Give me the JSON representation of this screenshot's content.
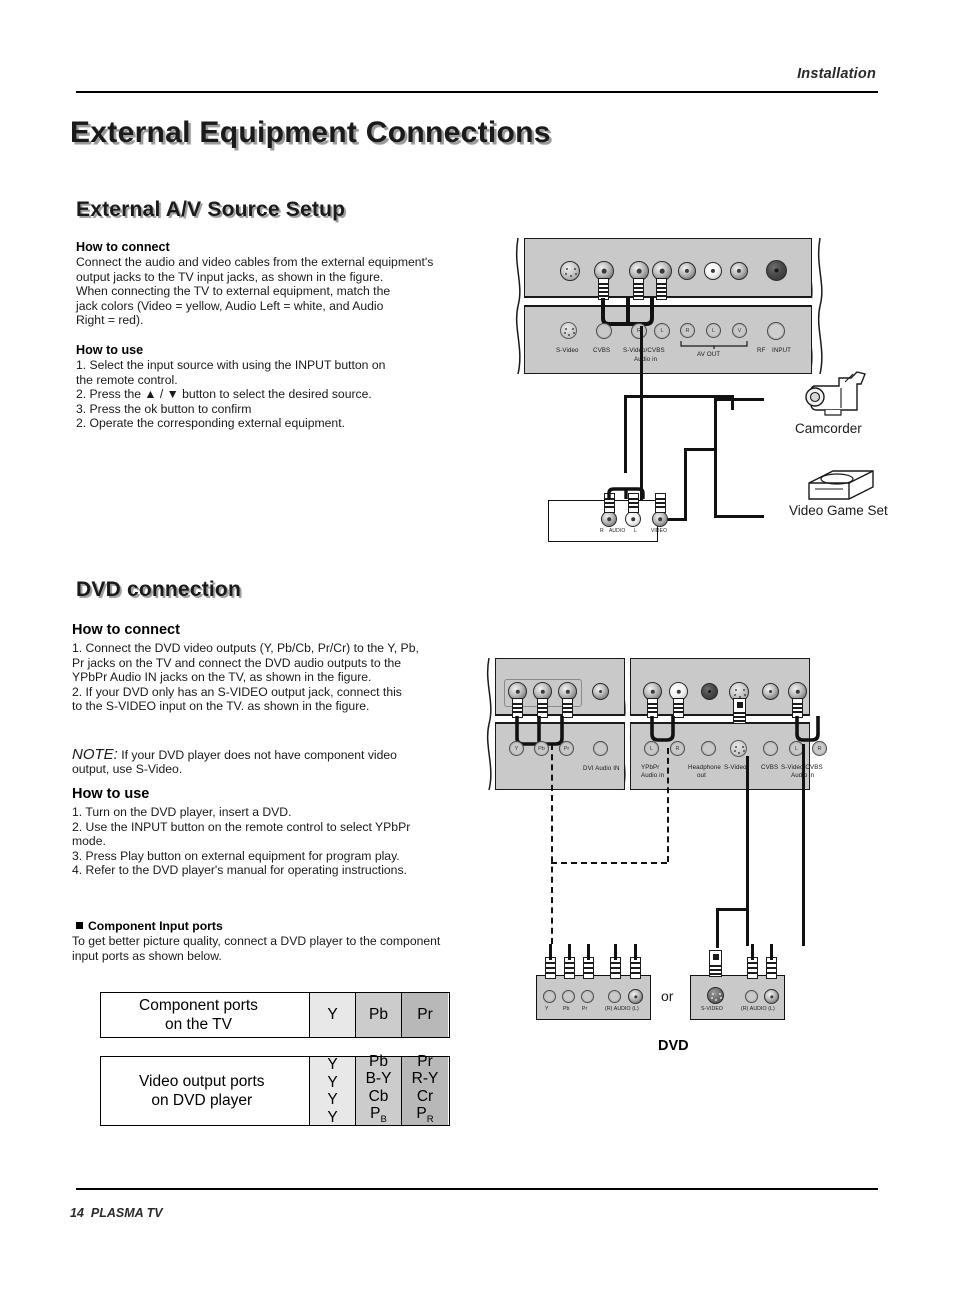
{
  "header": {
    "section": "Installation"
  },
  "titles": {
    "h1": "External Equipment Connections",
    "av_setup": "External A/V Source Setup",
    "dvd_connection": "DVD connection"
  },
  "av_section": {
    "how_to_connect_heading": "How to connect",
    "how_to_connect_body": "Connect the audio and video cables from the external equipment's\noutput jacks to the TV input jacks, as shown in the figure.\nWhen connecting the TV to external equipment, match the\njack colors (Video = yellow, Audio Left = white, and Audio\nRight = red).",
    "how_to_use_heading": "How to use",
    "how_to_use_body": "1. Select the input source with using the INPUT button on\nthe remote control.\n2. Press the ▲ / ▼ button to select the desired source.\n3. Press the ok  button to confirm\n2. Operate the corresponding external equipment."
  },
  "dvd_section": {
    "how_to_connect_heading": "How to connect",
    "how_to_connect_body": "1. Connect the DVD video outputs (Y, Pb/Cb, Pr/Cr) to the Y, Pb,\nPr jacks on the TV and connect the DVD audio outputs to the\nYPbPr Audio IN  jacks on the TV, as shown in the figure.\n2. If your DVD only has an S-VIDEO output jack, connect  this\nto  the S-VIDEO input on the TV. as shown in the figure.",
    "note_label": "NOTE:",
    "note_body": " If your DVD player does not have component video\noutput, use S-Video.",
    "how_to_use_heading": "How to use",
    "how_to_use_body": "1. Turn on the DVD player, insert a DVD.\n2. Use the INPUT button on the remote control to select YPbPr\nmode.\n3. Press Play button on external equipment for program play.\n4. Refer to the DVD player's manual for operating instructions."
  },
  "component_ports": {
    "heading": "Component Input ports",
    "body": "To get better picture quality, connect a DVD player to the component\ninput ports as shown below."
  },
  "tables": {
    "tv_row": {
      "label": "Component ports\non the TV",
      "cols": [
        "Y",
        "Pb",
        "Pr"
      ]
    },
    "dvd_row": {
      "label": "Video output ports\non DVD player",
      "col_y": [
        "Y",
        "Y",
        "Y",
        "Y"
      ],
      "col_pb": [
        "Pb",
        "B-Y",
        "Cb",
        "P"
      ],
      "col_pb_sub": "B",
      "col_pr": [
        "Pr",
        "R-Y",
        "Cr",
        "P"
      ],
      "col_pr_sub": "R"
    },
    "shades": {
      "y": "#e8e8e8",
      "pb": "#cccccc",
      "pr": "#b8b8b8"
    }
  },
  "diagram_av": {
    "jack_labels": [
      "S-Video",
      "CVBS",
      "S-Video/CVBS",
      "Audio in",
      "AV OUT",
      "RF",
      "INPUT"
    ],
    "av_out_pins": [
      "R",
      "L",
      "V"
    ],
    "device_panel_labels": [
      "R",
      "AUDIO",
      "L",
      "VIDEO"
    ],
    "camcorder_label": "Camcorder",
    "video_game_label": "Video Game Set"
  },
  "diagram_dvd": {
    "component_pins": [
      "Y",
      "Pb",
      "Pr"
    ],
    "dvi_audio_label": "DVI Audio IN",
    "ypbpr_pins": [
      "L",
      "R"
    ],
    "ypbpr_label": "YPbPr\nAudio in",
    "headphone_label": "Headphone\nout",
    "svideo_label": "S-Video",
    "cvbs_label": "CVBS",
    "svideo_cvbs_label": "S-Video/CVBS",
    "audio_in_label": "Audio in",
    "svideo_cvbs_pins": [
      "L",
      "R"
    ],
    "dvd_panel_left_labels": [
      "Y",
      "Pb",
      "Pr",
      "(R) AUDIO (L)"
    ],
    "dvd_panel_right_labels": [
      "S-VIDEO",
      "(R) AUDIO (L)"
    ],
    "or_text": "or",
    "dvd_label": "DVD"
  },
  "footer": {
    "page_number": "14",
    "product": "PLASMA TV"
  }
}
